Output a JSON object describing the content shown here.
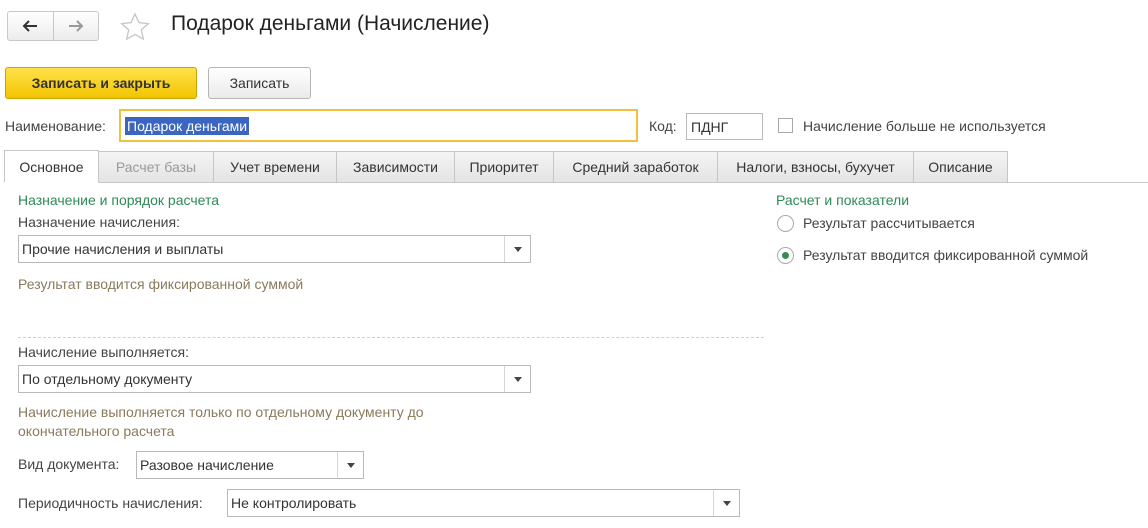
{
  "header": {
    "back_icon": "arrow-left-icon",
    "forward_icon": "arrow-right-icon",
    "favorite_icon": "star-icon",
    "title": "Подарок деньгами (Начисление)"
  },
  "toolbar": {
    "save_close_label": "Записать и закрыть",
    "save_label": "Записать"
  },
  "fields": {
    "name_label": "Наименование:",
    "name_value": "Подарок деньгами",
    "code_label": "Код:",
    "code_value": "ПДНГ",
    "unused_label": "Начисление больше не используется",
    "unused_checked": false
  },
  "tabs": [
    {
      "label": "Основное",
      "state": "active"
    },
    {
      "label": "Расчет базы",
      "state": "disabled"
    },
    {
      "label": "Учет времени",
      "state": "normal"
    },
    {
      "label": "Зависимости",
      "state": "normal"
    },
    {
      "label": "Приоритет",
      "state": "normal"
    },
    {
      "label": "Средний заработок",
      "state": "normal"
    },
    {
      "label": "Налоги, взносы, бухучет",
      "state": "normal"
    },
    {
      "label": "Описание",
      "state": "normal"
    }
  ],
  "left": {
    "section_title": "Назначение и порядок расчета",
    "purpose_label": "Назначение начисления:",
    "purpose_value": "Прочие начисления и выплаты",
    "purpose_hint": "Результат вводится фиксированной суммой",
    "execution_label": "Начисление выполняется:",
    "execution_value": "По отдельному документу",
    "execution_hint_1": "Начисление выполняется только по отдельному документу до",
    "execution_hint_2": "окончательного расчета",
    "doc_type_label": "Вид документа:",
    "doc_type_value": "Разовое начисление",
    "periodicity_label": "Периодичность начисления:",
    "periodicity_value": "Не контролировать"
  },
  "right": {
    "section_title": "Расчет и показатели",
    "radio_options": [
      {
        "label": "Результат рассчитывается",
        "selected": false
      },
      {
        "label": "Результат вводится фиксированной суммой",
        "selected": true
      }
    ]
  },
  "colors": {
    "accent_yellow": "#f2c400",
    "section_green": "#2e8a57",
    "hint_brown": "#8a7a5c",
    "selection_blue": "#3a65c0"
  }
}
